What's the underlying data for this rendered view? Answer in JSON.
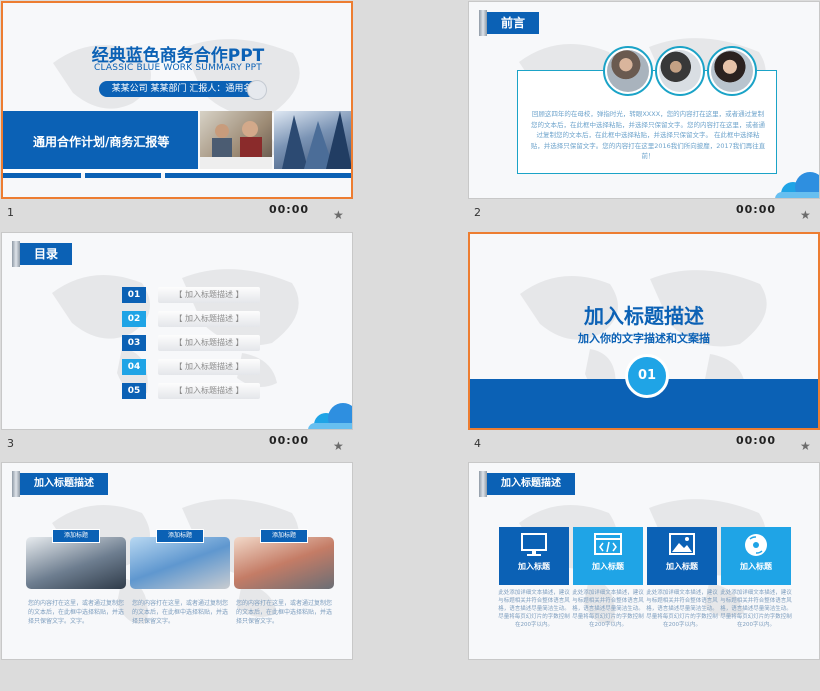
{
  "slides": [
    {
      "number": "1",
      "time": "00:00",
      "title": "经典蓝色商务合作PPT",
      "subtitle": "CLASSIC BLUE WORK SUMMARY PPT",
      "pill": "某某公司 某某部门 汇报人：通用名",
      "band": "通用合作计划/商务汇报等"
    },
    {
      "number": "2",
      "time": "00:00",
      "tag": "前言",
      "body": "回顾这四年的在母校，弹指时光，转眼XXXX，您的内容打在这里，或者通过复制您的文本后，在此框中选择粘贴，并选择只保留文字。您的内容打在这里，或者通过复制您的文本后，在此框中选择粘贴，并选择只保留文字。 在此框中选择粘贴，并选择只保留文字。您的内容打在这里2016我们所向披靡，2017我们再往直前！"
    },
    {
      "number": "3",
      "time": "00:00",
      "tag": "目录",
      "items": [
        {
          "num": "01",
          "label": "【 加入标题描述 】"
        },
        {
          "num": "02",
          "label": "【 加入标题描述 】"
        },
        {
          "num": "03",
          "label": "【 加入标题描述 】"
        },
        {
          "num": "04",
          "label": "【 加入标题描述 】"
        },
        {
          "num": "05",
          "label": "【 加入标题描述 】"
        }
      ]
    },
    {
      "number": "4",
      "time": "00:00",
      "title": "加入标题描述",
      "subtitle": "加入你的文字描述和文案描",
      "badge": "01"
    },
    {
      "tag": "加入标题描述",
      "cards": [
        {
          "label": "添加标题",
          "text": "您的内容打在这里，或者通过复制您的文本后，在此框中选择粘贴，并选择只保留文字。文字。"
        },
        {
          "label": "添加标题",
          "text": "您的内容打在这里，或者通过复制您的文本后，在此框中选择粘贴，并选择只保留文字。"
        },
        {
          "label": "添加标题",
          "text": "您的内容打在这里，或者通过复制您的文本后，在此框中选择粘贴，并选择只保留文字。"
        }
      ]
    },
    {
      "tag": "加入标题描述",
      "boxes": [
        {
          "label": "加入标题",
          "icon": "monitor-icon",
          "color": "#0b61b5",
          "text": "此处添加详细文本描述，建议与标题相关并符合整体语言风格，语言描述尽量简洁生动。尽量将每页幻灯片的字数控制在200字以内。"
        },
        {
          "label": "加入标题",
          "icon": "code-icon",
          "color": "#1fa4e6",
          "text": "此处添加详细文本描述，建议与标题相关并符合整体语言风格，语言描述尽量简洁生动。尽量将每页幻灯片的字数控制在200字以内。"
        },
        {
          "label": "加入标题",
          "icon": "image-icon",
          "color": "#0b61b5",
          "text": "此处添加详细文本描述，建议与标题相关并符合整体语言风格，语言描述尽量简洁生动。尽量将每页幻灯片的字数控制在200字以内。"
        },
        {
          "label": "加入标题",
          "icon": "disc-icon",
          "color": "#1fa4e6",
          "text": "此处添加详细文本描述，建议与标题相关并符合整体语言风格，语言描述尽量简洁生动。尽量将每页幻灯片的字数控制在200字以内。"
        }
      ]
    }
  ],
  "colors": {
    "primary": "#0b61b5",
    "accent": "#1fa4e6",
    "selected_border": "#ed7d31"
  }
}
